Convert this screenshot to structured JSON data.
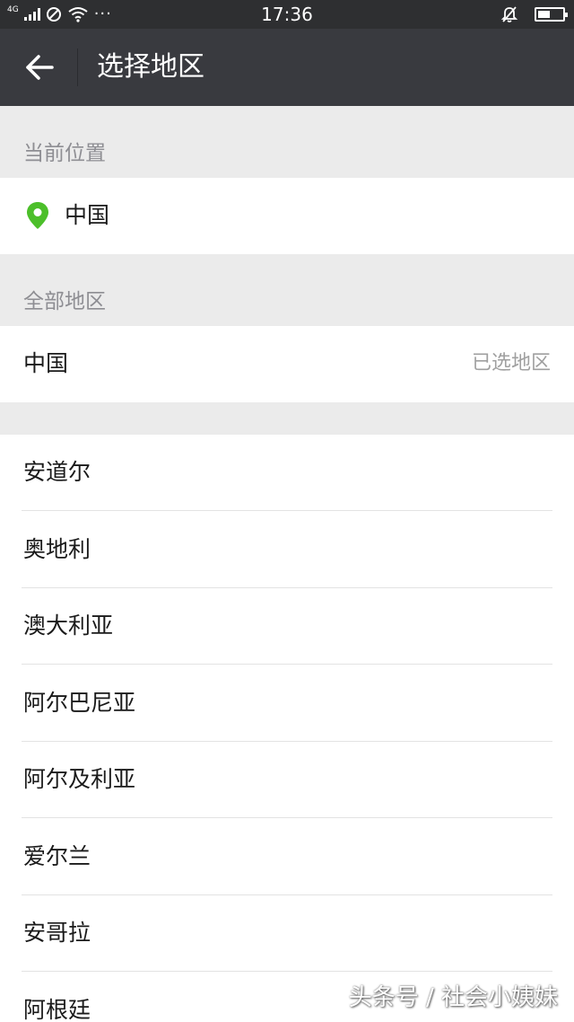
{
  "status_bar": {
    "network_label": "4G",
    "time": "17:36",
    "more_dots": "···",
    "battery_level": 0.5
  },
  "app_bar": {
    "title": "选择地区"
  },
  "current_location": {
    "section_label": "当前位置",
    "location": "中国",
    "icon_color": "#4cbf2a"
  },
  "all_regions": {
    "section_label": "全部地区",
    "selected_region": "中国",
    "selected_hint": "已选地区"
  },
  "countries": [
    "安道尔",
    "奥地利",
    "澳大利亚",
    "阿尔巴尼亚",
    "阿尔及利亚",
    "爱尔兰",
    "安哥拉",
    "阿根廷"
  ],
  "watermark": "头条号 / 社会小姨妹",
  "colors": {
    "status_bar_bg": "#2e2f31",
    "app_bar_bg": "#393a3f",
    "page_bg": "#ebebeb"
  }
}
